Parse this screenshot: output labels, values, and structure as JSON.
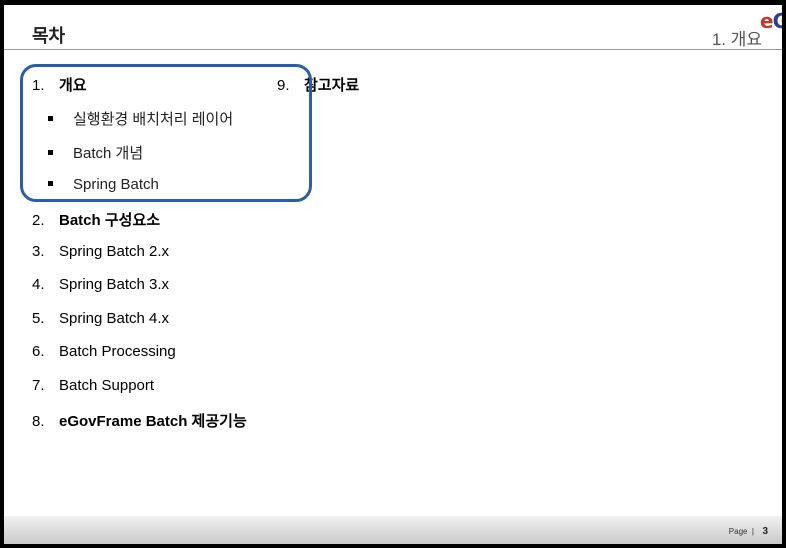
{
  "header": {
    "title": "목차",
    "section": "1. 개요",
    "logo_e": "e",
    "logo_g": "G"
  },
  "toc": [
    {
      "num": "1.",
      "label": "개요"
    },
    {
      "num": "2.",
      "label": "Batch 구성요소"
    },
    {
      "num": "3.",
      "label": "Spring Batch 2.x"
    },
    {
      "num": "4.",
      "label": "Spring Batch 3.x"
    },
    {
      "num": "5.",
      "label": "Spring Batch 4.x"
    },
    {
      "num": "6.",
      "label": "Batch Processing"
    },
    {
      "num": "7.",
      "label": "Batch Support"
    },
    {
      "num": "8.",
      "label": "eGovFrame Batch 제공기능"
    },
    {
      "num": "9.",
      "label": "참고자료"
    }
  ],
  "subitems": [
    {
      "label": "실행환경 배치처리 레이어"
    },
    {
      "label": "Batch 개념"
    },
    {
      "label": "Spring Batch"
    }
  ],
  "footer": {
    "page_label": "Page",
    "separator": "|",
    "page_number": "3"
  },
  "colors": {
    "highlight": "#2a5ea8",
    "logo_e": "#c0392b",
    "logo_g": "#2c3e8f"
  }
}
